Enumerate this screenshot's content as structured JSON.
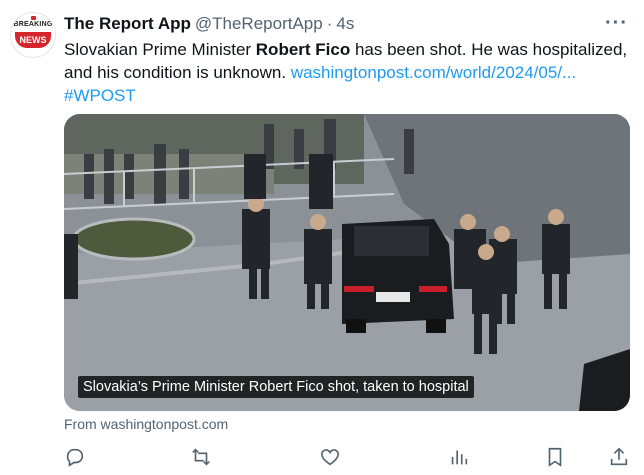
{
  "tweet": {
    "author_name": "The Report App",
    "author_handle": "@TheReportApp",
    "separator": "·",
    "time": "4s",
    "text_part1": "Slovakian Prime Minister ",
    "text_bold": "Robert Fico",
    "text_part2": " has been shot. He was hospitalized, and his condition is unknown. ",
    "link": "washingtonpost.com/world/2024/05/...",
    "hashtag": "#WPOST",
    "media_caption": "Slovakia’s Prime Minister Robert Fico shot, taken to hospital",
    "source": "From washingtonpost.com",
    "more_label": "···"
  },
  "avatar": {
    "line1": "BREAKING",
    "line2": "NEWS",
    "accent": "#d7262b"
  },
  "actions": [
    {
      "name": "reply",
      "icon": "reply-icon"
    },
    {
      "name": "retweet",
      "icon": "retweet-icon"
    },
    {
      "name": "like",
      "icon": "heart-icon"
    },
    {
      "name": "views",
      "icon": "analytics-icon"
    },
    {
      "name": "bookmark",
      "icon": "bookmark-icon"
    },
    {
      "name": "share",
      "icon": "share-icon"
    }
  ],
  "colors": {
    "text": "#0f1419",
    "secondary": "#536471",
    "link": "#1d9bf0"
  }
}
